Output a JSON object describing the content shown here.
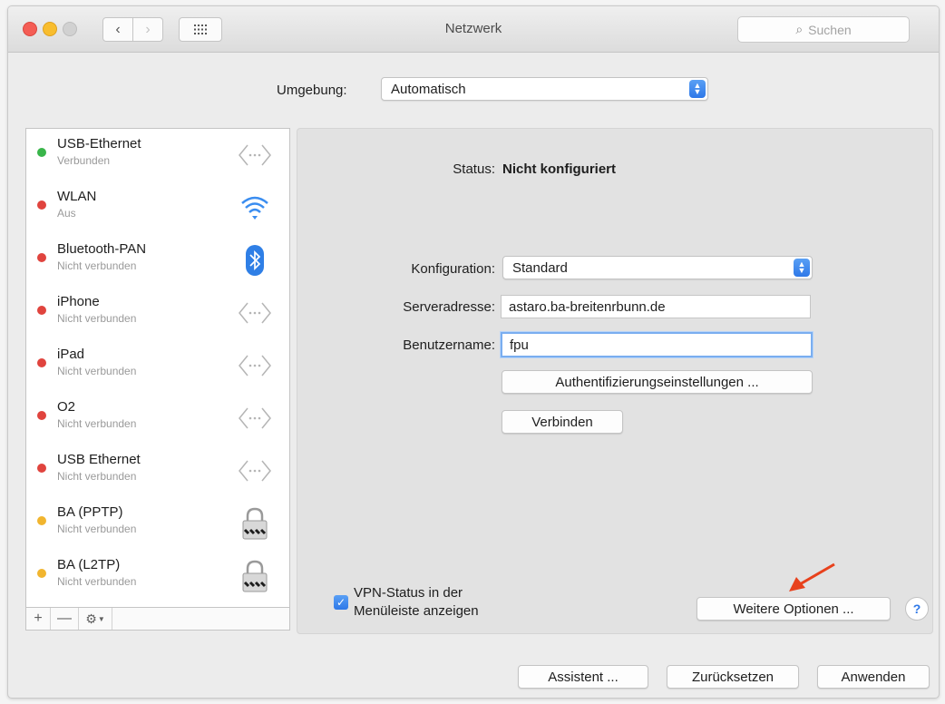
{
  "window": {
    "title": "Netzwerk"
  },
  "toolbar": {
    "search_placeholder": "Suchen"
  },
  "umgebung": {
    "label": "Umgebung:",
    "value": "Automatisch"
  },
  "services": [
    {
      "name": "USB-Ethernet",
      "status": "Verbunden",
      "dot": "green",
      "icon": "ethernet-icon"
    },
    {
      "name": "WLAN",
      "status": "Aus",
      "dot": "red",
      "icon": "wifi-icon"
    },
    {
      "name": "Bluetooth-PAN",
      "status": "Nicht verbunden",
      "dot": "red",
      "icon": "bluetooth-icon"
    },
    {
      "name": "iPhone",
      "status": "Nicht verbunden",
      "dot": "red",
      "icon": "ethernet-icon"
    },
    {
      "name": "iPad",
      "status": "Nicht verbunden",
      "dot": "red",
      "icon": "ethernet-icon"
    },
    {
      "name": "O2",
      "status": "Nicht verbunden",
      "dot": "red",
      "icon": "ethernet-icon"
    },
    {
      "name": "USB Ethernet",
      "status": "Nicht verbunden",
      "dot": "red",
      "icon": "ethernet-icon"
    },
    {
      "name": "BA (PPTP)",
      "status": "Nicht verbunden",
      "dot": "yellow",
      "icon": "vpn-lock-icon"
    },
    {
      "name": "BA (L2TP)",
      "status": "Nicht verbunden",
      "dot": "yellow",
      "icon": "vpn-lock-icon"
    }
  ],
  "sidebar_buttons": {
    "add": "+",
    "remove": "—"
  },
  "detail": {
    "status_label": "Status:",
    "status_value": "Nicht konfiguriert",
    "config_label": "Konfiguration:",
    "config_value": "Standard",
    "server_label": "Serveradresse:",
    "server_value": "astaro.ba-breitenrbunn.de",
    "user_label": "Benutzername:",
    "user_value": "fpu",
    "auth_button": "Authentifizierungseinstellungen ...",
    "connect_button": "Verbinden",
    "vpn_status_line1": "VPN-Status in der",
    "vpn_status_line2": "Menüleiste anzeigen",
    "vpn_status_checked": true,
    "more_options_button": "Weitere Optionen ...",
    "help_label": "?"
  },
  "footer": {
    "assistant_button": "Assistent ...",
    "revert_button": "Zurücksetzen",
    "apply_button": "Anwenden"
  },
  "colors": {
    "accent": "#2e78e8",
    "dot_green": "#39b54a",
    "dot_red": "#e0443e",
    "dot_yellow": "#f1b52f",
    "arrow": "#e8411c"
  }
}
